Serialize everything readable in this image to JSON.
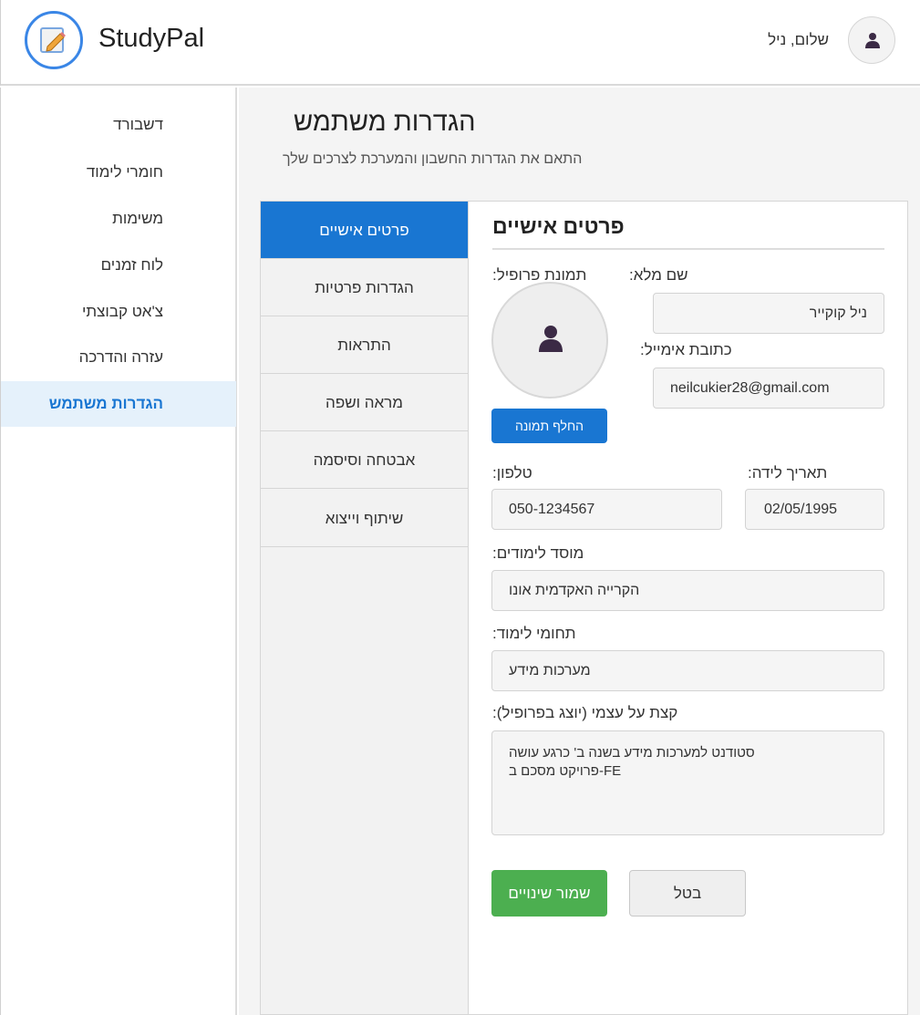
{
  "app": {
    "brand": "StudyPal",
    "greeting": "שלום, ניל"
  },
  "sidebar": {
    "items": [
      {
        "label": "דשבורד"
      },
      {
        "label": "חומרי לימוד"
      },
      {
        "label": "משימות"
      },
      {
        "label": "לוח זמנים"
      },
      {
        "label": "צ'אט קבוצתי"
      },
      {
        "label": "עזרה והדרכה"
      },
      {
        "label": "הגדרות משתמש",
        "active": true
      }
    ]
  },
  "page": {
    "title": "הגדרות משתמש",
    "subtitle": "התאם את הגדרות החשבון והמערכת לצרכים שלך"
  },
  "tabs": [
    {
      "label": "פרטים אישיים",
      "active": true
    },
    {
      "label": "הגדרות פרטיות"
    },
    {
      "label": "התראות"
    },
    {
      "label": "מראה ושפה"
    },
    {
      "label": "אבטחה וסיסמה"
    },
    {
      "label": "שיתוף וייצוא"
    }
  ],
  "form": {
    "section_title": "פרטים אישיים",
    "full_name_label": ":שם מלא",
    "full_name_value": "ניל קוקייר",
    "email_label": ":כתובת אימייל",
    "email_value": "neilcukier28@gmail.com",
    "photo_label": ":תמונת פרופיל",
    "change_photo_button": "החלף תמונה",
    "birthdate_label": ":תאריך לידה",
    "birthdate_value": "02/05/1995",
    "phone_label": ":טלפון",
    "phone_value": "050-1234567",
    "institution_label": ":מוסד לימודים",
    "institution_value": "הקרייה האקדמית אונו",
    "field_of_study_label": ":תחומי לימוד",
    "field_of_study_value": "מערכות מידע",
    "bio_label": ":קצת על עצמי (יוצג בפרופיל)",
    "bio_line1": "סטודנט למערכות מידע בשנה ב' כרגע עושה",
    "bio_line2": "FE-פרויקט מסכם ב",
    "save_button": "שמור שינויים",
    "cancel_button": "בטל"
  },
  "colors": {
    "primary": "#1976d2",
    "success": "#4caf50",
    "sidebar_active_bg": "#e5f1fb"
  },
  "icons": {
    "logo": "pencil-note-icon",
    "avatar": "user-silhouette-icon"
  }
}
